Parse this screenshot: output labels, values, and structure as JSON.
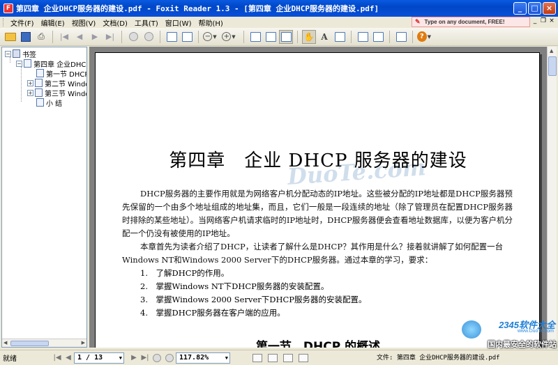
{
  "window": {
    "title": "第四章 企业DHCP服务器的建设.pdf - Foxit Reader 1.3 - [第四章 企业DHCP服务器的建设.pdf]",
    "minimize": "_",
    "maximize": "□",
    "close": "×"
  },
  "menu": {
    "items": [
      "文件(F)",
      "编辑(E)",
      "视图(V)",
      "文档(D)",
      "工具(T)",
      "窗口(W)",
      "帮助(H)"
    ],
    "promo": "Type on any document, FREE!"
  },
  "sidebar": {
    "root": "书签",
    "items": [
      {
        "label": "第四章 企业DHCP",
        "expander": "−"
      },
      {
        "label": "第一节 DHCP"
      },
      {
        "label": "第二节 Windo",
        "expander": "+"
      },
      {
        "label": "第三节 Windo",
        "expander": "+"
      },
      {
        "label": "小 结"
      }
    ]
  },
  "document": {
    "title": "第四章　企业 DHCP 服务器的建设",
    "para1": "DHCP服务器的主要作用就是为网络客户机分配动态的IP地址。这些被分配的IP地址都是DHCP服务器预先保留的一个由多个地址组成的地址集，而且，它们一般是一段连续的地址（除了管理员在配置DHCP服务器时排除的某些地址）。当网络客户机请求临时的IP地址时，DHCP服务器便会查看地址数据库，以便为客户机分配一个仍没有被使用的IP地址。",
    "para2": "本章首先为读者介绍了DHCP，让读者了解什么是DHCP？其作用是什么？接着就讲解了如何配置一台Windows NT和Windows 2000 Server下的DHCP服务器。通过本章的学习，要求：",
    "list": [
      "1.　了解DHCP的作用。",
      "2.　掌握Windows NT下DHCP服务器的安装配置。",
      "3.　掌握Windows 2000 Server下DHCP服务器的安装配置。",
      "4.　掌握DHCP服务器在客户端的应用。"
    ],
    "section": "第一节　DHCP 的概述",
    "watermark": "DuoTe.com"
  },
  "status": {
    "ready": "就绪",
    "page": "1 / 13",
    "zoom": "117.82%",
    "file": "文件: 第四章 企业DHCP服务器的建设.pdf"
  },
  "brand": {
    "name": "2345软件大全",
    "url": "www.DuoTe.com",
    "slogan": "国内最安全的软件站"
  }
}
